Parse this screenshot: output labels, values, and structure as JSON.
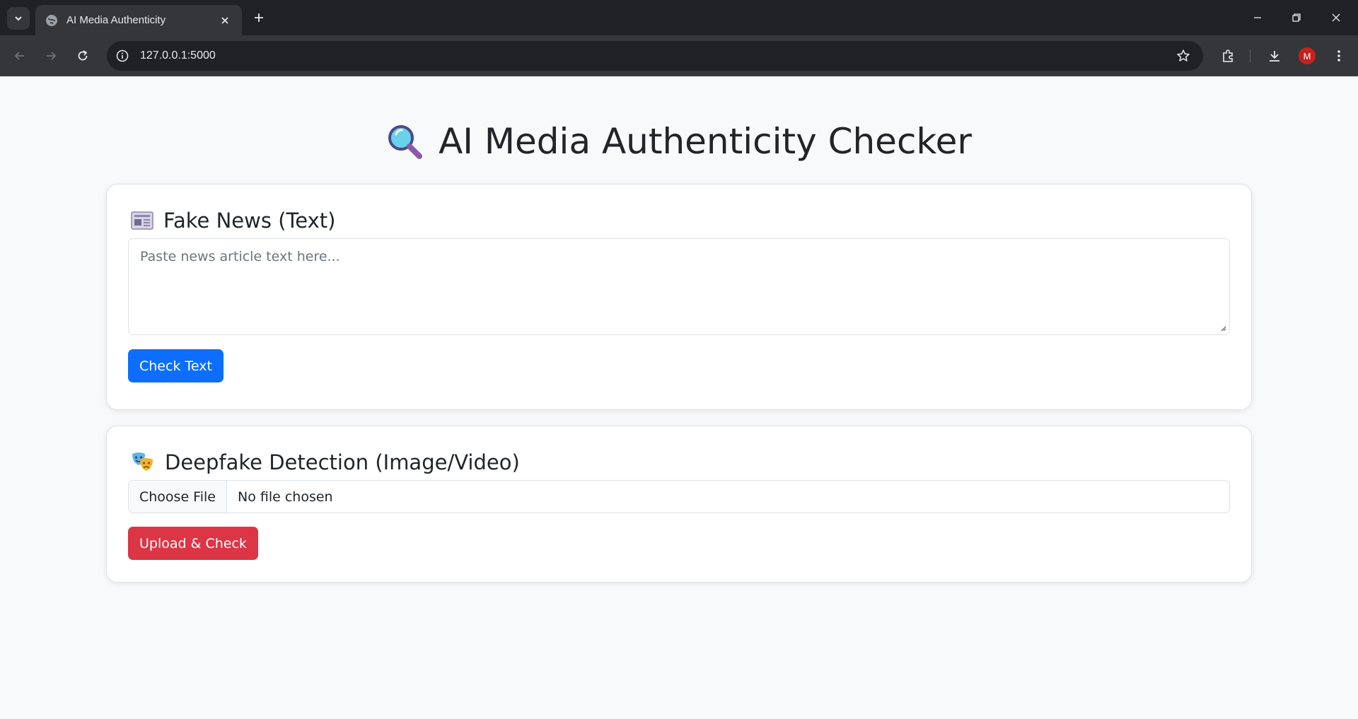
{
  "browser": {
    "tab_title": "AI Media Authenticity",
    "url": "127.0.0.1:5000",
    "profile_initial": "M"
  },
  "page": {
    "title": "AI Media Authenticity Checker",
    "title_icon": "magnifier-icon"
  },
  "fake_news": {
    "heading": "Fake News (Text)",
    "heading_icon": "newspaper-icon",
    "textarea_placeholder": "Paste news article text here...",
    "button_label": "Check Text"
  },
  "deepfake": {
    "heading": "Deepfake Detection (Image/Video)",
    "heading_icon": "theater-masks-icon",
    "file_button_label": "Choose File",
    "file_status": "No file chosen",
    "button_label": "Upload & Check"
  },
  "colors": {
    "primary": "#0d6efd",
    "danger": "#dc3545",
    "background": "#f8f9fa"
  }
}
